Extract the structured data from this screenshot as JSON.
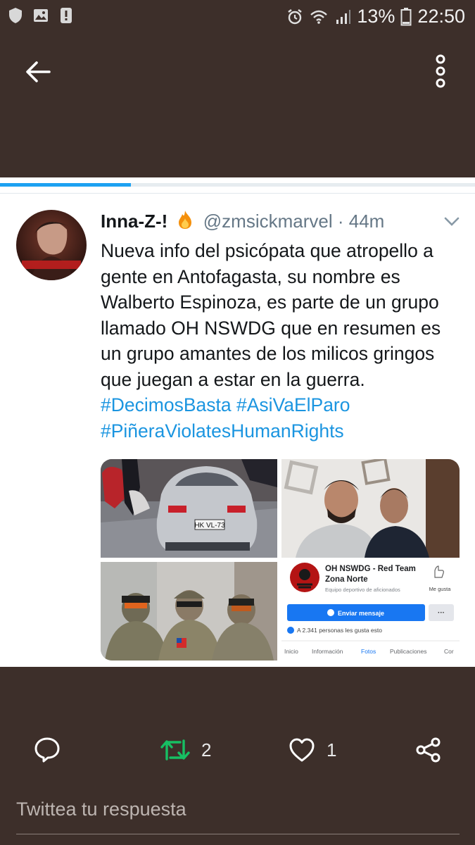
{
  "status_bar": {
    "battery": "13%",
    "time": "22:50"
  },
  "progress": {
    "fraction": 0.275,
    "color": "#1da1f2"
  },
  "tweet": {
    "display_name": "Inna-Z-!",
    "handle": "@zmsickmarvel",
    "separator": "·",
    "time": "44m",
    "text_lines": [
      "Nueva info del psicópata que atropello a",
      "gente en Antofagasta, su nombre es",
      "Walberto Espinoza, es parte de un grupo",
      "llamado OH NSWDG que en resumen es",
      "un grupo amantes de los milicos gringos",
      "que juegan a estar en la guerra."
    ],
    "hashtags": [
      "#DecimosBasta",
      "#AsiVaElParo",
      "#PiñeraViolatesHumanRights"
    ],
    "media": {
      "car_plate": "HK VL-73",
      "fb_page": {
        "name_line1": "OH NSWDG - Red Team",
        "name_line2": "Zona Norte",
        "category": "Equipo deportivo de aficionados",
        "like_label": "Me gusta",
        "message_button": "Enviar mensaje",
        "more_button": "···",
        "likes_text": "A 2.341 personas les gusta esto",
        "tabs": [
          "Inicio",
          "Información",
          "Fotos",
          "Publicaciones",
          "Cor"
        ]
      }
    }
  },
  "actions": {
    "retweet_count": "2",
    "like_count": "1",
    "retweet_color": "#17bf63"
  },
  "reply": {
    "placeholder": "Twittea tu respuesta"
  },
  "colors": {
    "background": "#3d2f2a",
    "link": "#1b95e0"
  }
}
